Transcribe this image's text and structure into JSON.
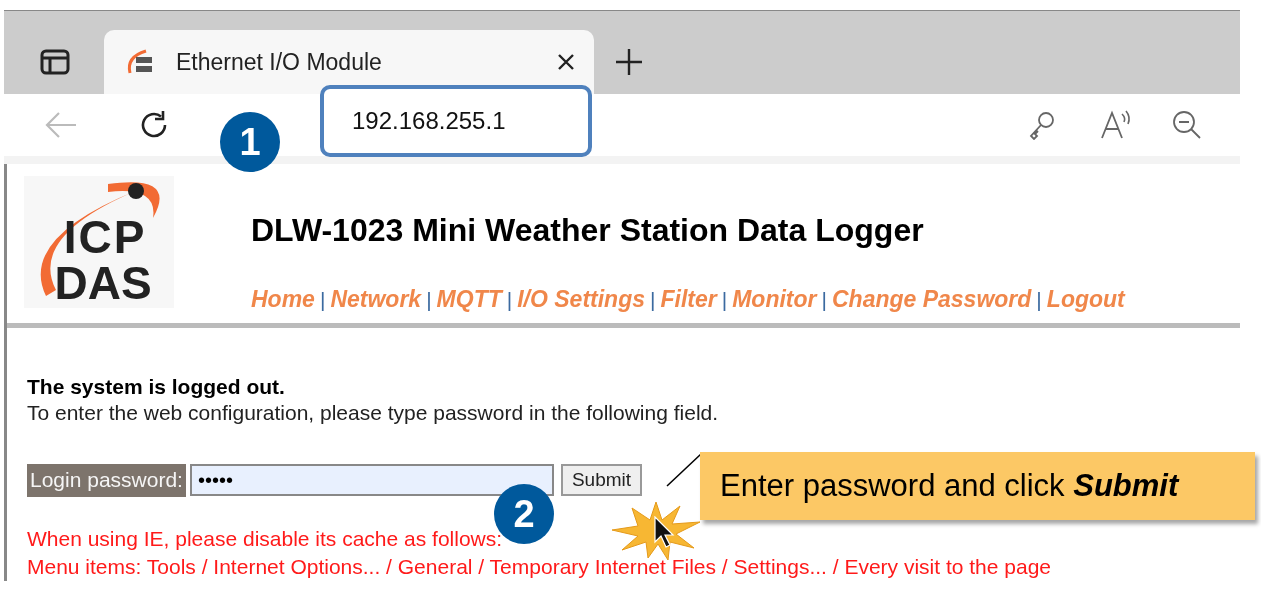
{
  "browser": {
    "tab": {
      "title": "Ethernet I/O Module",
      "selected": true
    },
    "address": "192.168.255.1"
  },
  "page": {
    "logo": {
      "line1": "ICP",
      "line2": "DAS"
    },
    "title": "DLW-1023 Mini Weather Station Data Logger",
    "nav": [
      {
        "label": "Home",
        "separator": "|"
      },
      {
        "label": "Network",
        "separator": "|"
      },
      {
        "label": "MQTT",
        "separator": "|"
      },
      {
        "label": "I/O Settings",
        "separator": "|"
      },
      {
        "label": "Filter",
        "separator": "|"
      },
      {
        "label": "Monitor",
        "separator": "|"
      },
      {
        "label": "Change Password",
        "separator": "|"
      },
      {
        "label": "Logout"
      }
    ],
    "status": "The system is logged out.",
    "instructions": "To enter the web configuration, please type password in the following field.",
    "login": {
      "label": "Login password:",
      "value": "•••••",
      "button": "Submit"
    },
    "notes": [
      "When using IE, please disable its cache as follows:",
      "Menu items: Tools / Internet Options... / General / Temporary Internet Files / Settings... / Every visit to the page"
    ]
  },
  "annotations": {
    "badges": [
      "1",
      "2"
    ],
    "callout": "Enter password and click **Submit**"
  }
}
